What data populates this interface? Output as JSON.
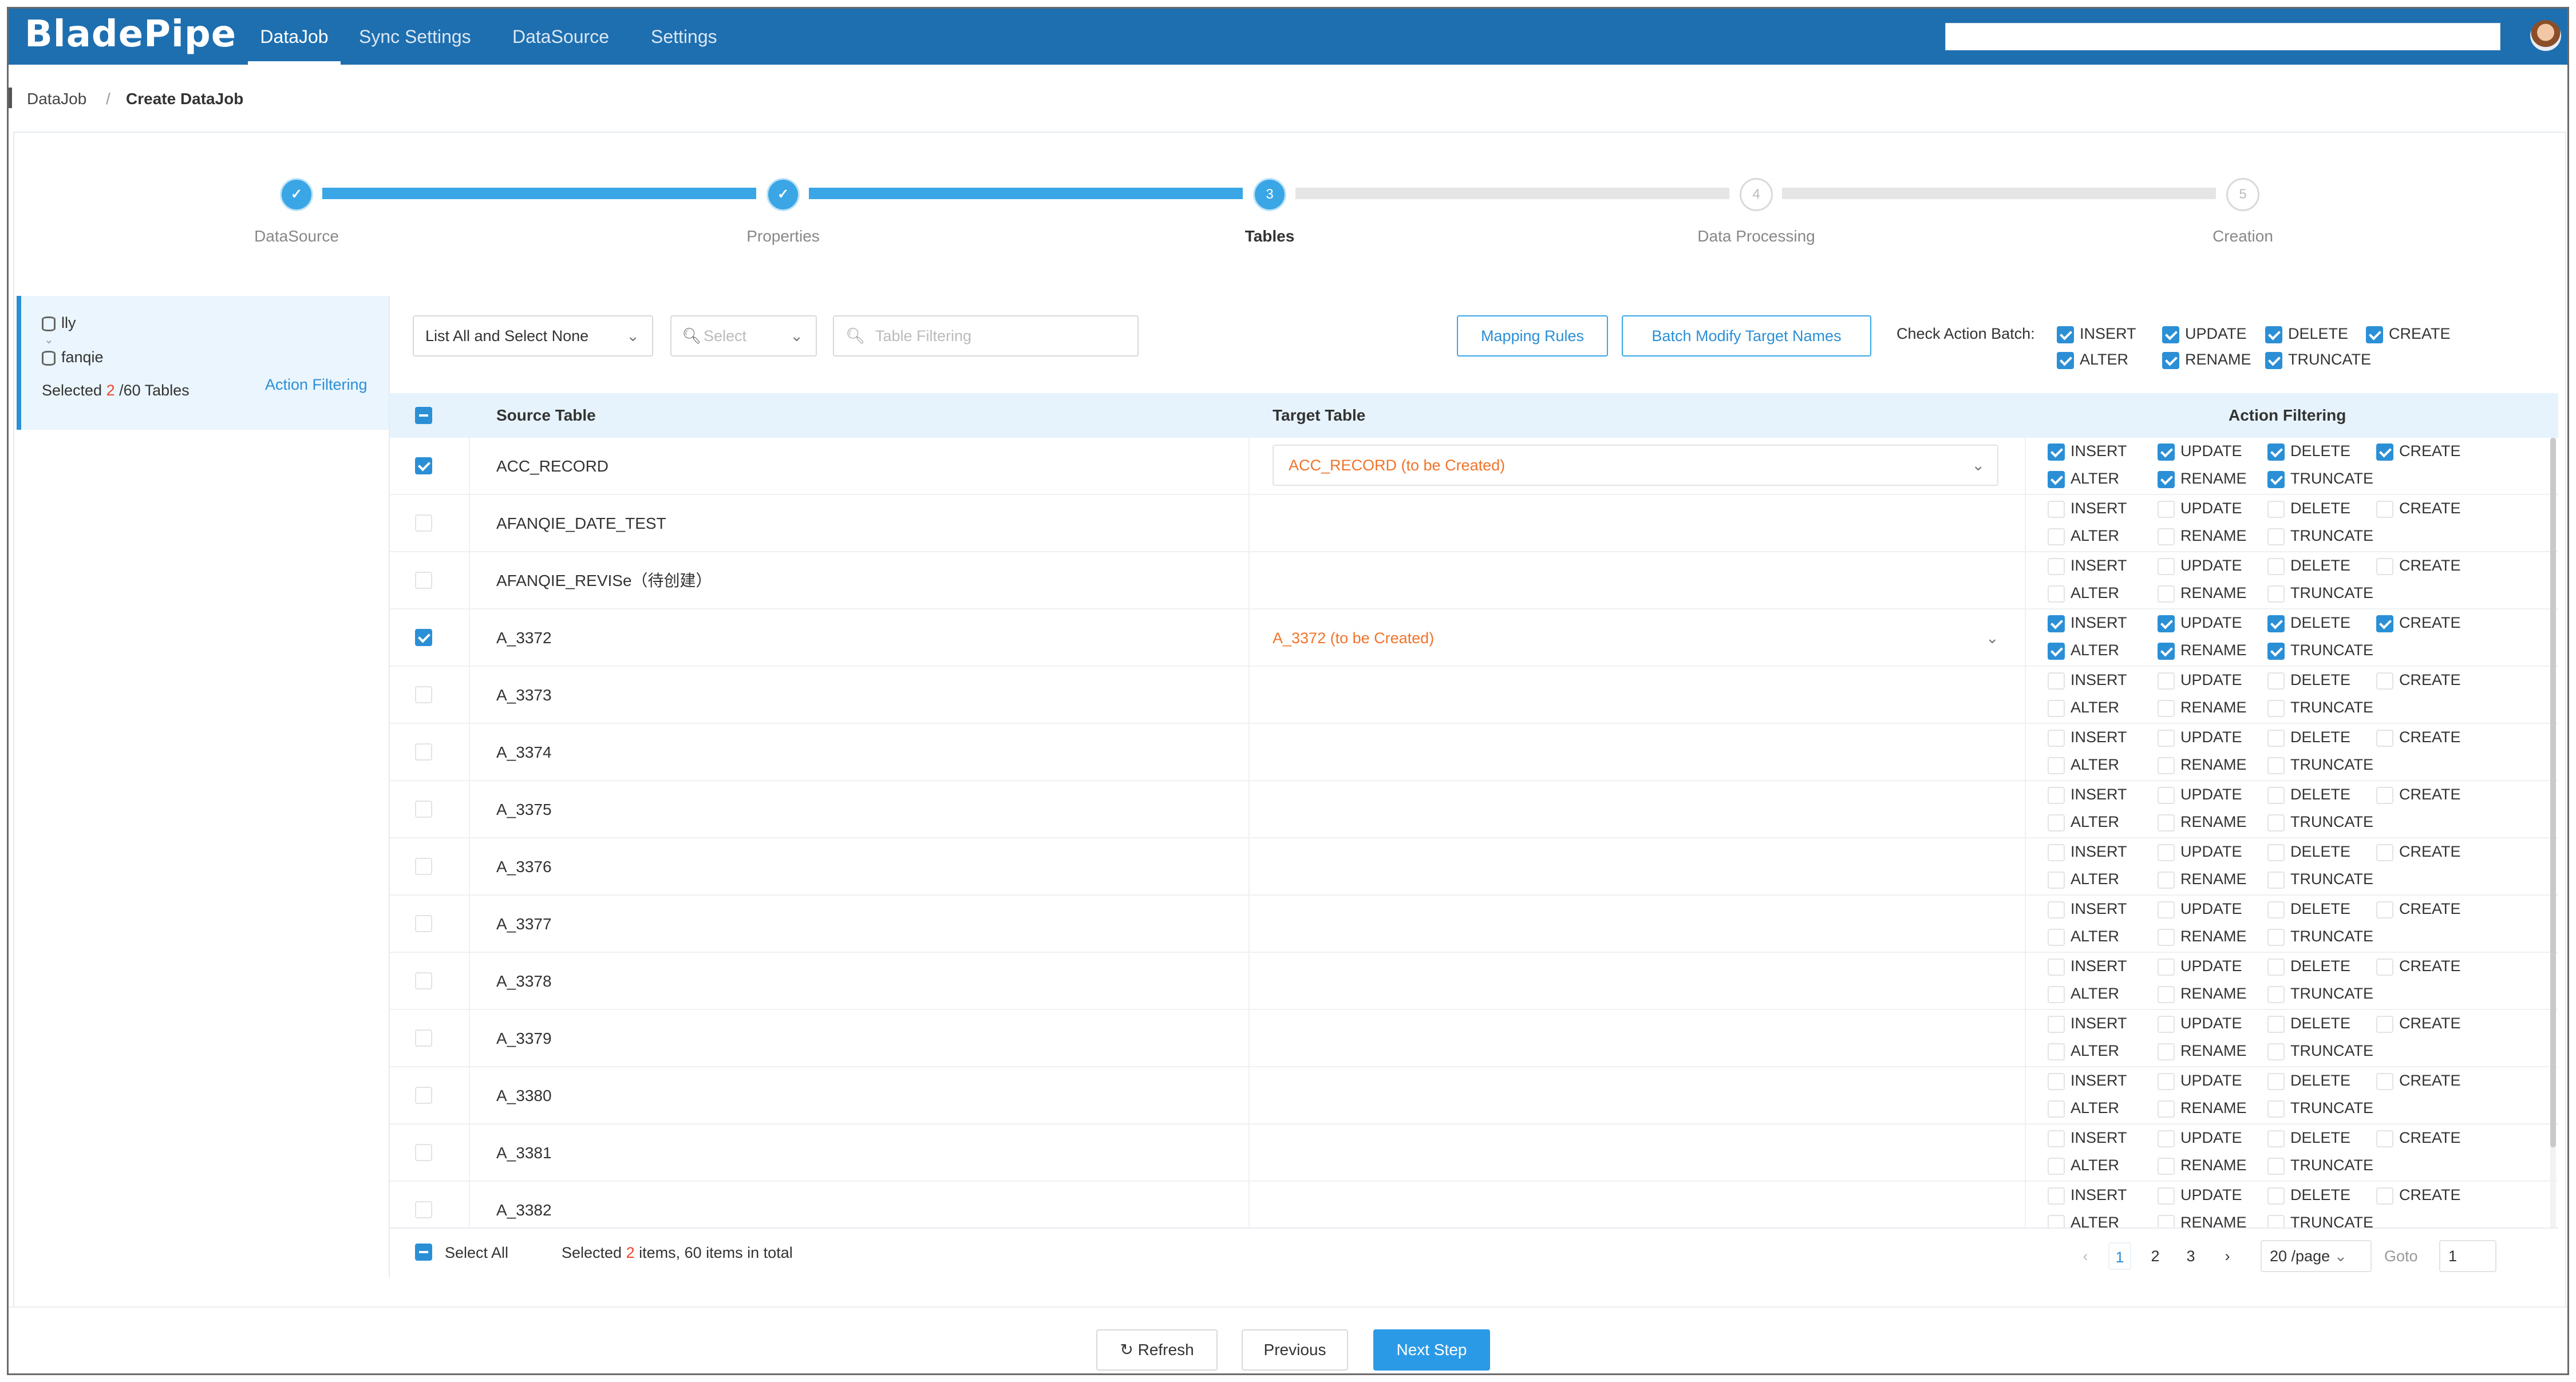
{
  "app": {
    "logo": "BladePipe",
    "search_value": ""
  },
  "nav": [
    {
      "label": "DataJob"
    },
    {
      "label": "Sync Settings"
    },
    {
      "label": "DataSource"
    },
    {
      "label": "Settings"
    }
  ],
  "breadcrumb": {
    "parent": "DataJob",
    "sep": "/",
    "current": "Create DataJob"
  },
  "steps": [
    {
      "num": "",
      "label": "DataSource",
      "state": "done"
    },
    {
      "num": "",
      "label": "Properties",
      "state": "done"
    },
    {
      "num": "3",
      "label": "Tables",
      "state": "current"
    },
    {
      "num": "4",
      "label": "Data Processing",
      "state": "todo"
    },
    {
      "num": "5",
      "label": "Creation",
      "state": "todo"
    }
  ],
  "left": {
    "db1": "lly",
    "db2": "fanqie",
    "selected_prefix": "Selected ",
    "selected_count": "2",
    "selected_suffix": " /60 Tables",
    "action_filtering": "Action Filtering"
  },
  "toolbar": {
    "list_select": "List All and Select None",
    "select_placeholder": "Select",
    "filter_placeholder": "Table Filtering",
    "mapping_rules": "Mapping Rules",
    "batch_modify": "Batch Modify Target Names",
    "check_action_batch": "Check Action Batch:"
  },
  "batch_actions": {
    "insert": "INSERT",
    "update": "UPDATE",
    "delete": "DELETE",
    "create": "CREATE",
    "alter": "ALTER",
    "rename": "RENAME",
    "truncate": "TRUNCATE"
  },
  "columns": {
    "source": "Source Table",
    "target": "Target Table",
    "action": "Action Filtering"
  },
  "action_labels": {
    "insert": "INSERT",
    "update": "UPDATE",
    "delete": "DELETE",
    "create": "CREATE",
    "alter": "ALTER",
    "rename": "RENAME",
    "truncate": "TRUNCATE"
  },
  "rows": [
    {
      "source": "ACC_RECORD",
      "target": "ACC_RECORD (to be Created)",
      "checked": true
    },
    {
      "source": "AFANQIE_DATE_TEST",
      "target": "",
      "checked": false
    },
    {
      "source": "AFANQIE_REVISe（待创建）",
      "target": "",
      "checked": false
    },
    {
      "source": "A_3372",
      "target": "A_3372 (to be Created)",
      "checked": true
    },
    {
      "source": "A_3373",
      "target": "",
      "checked": false
    },
    {
      "source": "A_3374",
      "target": "",
      "checked": false
    },
    {
      "source": "A_3375",
      "target": "",
      "checked": false
    },
    {
      "source": "A_3376",
      "target": "",
      "checked": false
    },
    {
      "source": "A_3377",
      "target": "",
      "checked": false
    },
    {
      "source": "A_3378",
      "target": "",
      "checked": false
    },
    {
      "source": "A_3379",
      "target": "",
      "checked": false
    },
    {
      "source": "A_3380",
      "target": "",
      "checked": false
    },
    {
      "source": "A_3381",
      "target": "",
      "checked": false
    },
    {
      "source": "A_3382",
      "target": "",
      "checked": false
    }
  ],
  "footer": {
    "select_all": "Select All",
    "selected_prefix": "Selected ",
    "selected_count": "2",
    "selected_suffix": " items, 60 items in total"
  },
  "pagination": {
    "prev": "‹",
    "pages": [
      "1",
      "2",
      "3"
    ],
    "next": "›",
    "page_size": "20 /page",
    "goto_label": "Goto",
    "goto_value": "1"
  },
  "bottom": {
    "refresh": "Refresh",
    "previous": "Previous",
    "next_step": "Next Step"
  },
  "colors": {
    "primary": "#2b8fd6",
    "header": "#1e6fb0",
    "warning": "#f0742c"
  }
}
